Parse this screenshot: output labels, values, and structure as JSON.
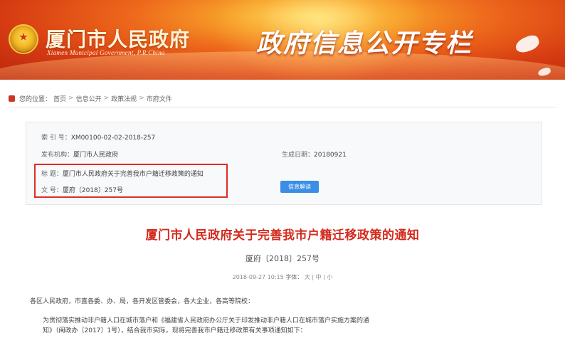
{
  "header": {
    "site_name": "厦门市人民政府",
    "site_en": "Xiamen Municipal Government, P.R.China",
    "column_title": "政府信息公开专栏"
  },
  "breadcrumb": {
    "label": "您的位置：",
    "items": [
      "首页",
      "信息公开",
      "政策法规",
      "市府文件"
    ],
    "separator": ">"
  },
  "info": {
    "index_label": "索 引 号：",
    "index_value": "XM00100-02-02-2018-257",
    "publisher_label": "发布机构：",
    "publisher_value": "厦门市人民政府",
    "date_label": "生成日期：",
    "date_value": "20180921",
    "title_label": "标 题：",
    "title_value": "厦门市人民政府关于完善我市户籍迁移政策的通知",
    "doc_no_label": "文 号：",
    "doc_no_value": "厦府〔2018〕257号",
    "view_button": "信息解读"
  },
  "document": {
    "title": "厦门市人民政府关于完善我市户籍迁移政策的通知",
    "number": "厦府〔2018〕257号",
    "meta_date": "2018-09-27 10:15",
    "meta_font_label": "字体：",
    "meta_font_options": [
      "大",
      "中",
      "小"
    ]
  },
  "body": {
    "line1": "各区人民政府，市直各委、办、局，各开发区管委会，各大企业，各高等院校：",
    "line2": "为贯彻落实推动非户籍人口在城市落户和《福建省人民政府办公厅关于印发推动非户籍人口在城市落户实施方案的通",
    "line3": "知》（闽政办〔2017〕1号），结合我市实际，现将完善我市户籍迁移政策有关事项通知如下："
  }
}
